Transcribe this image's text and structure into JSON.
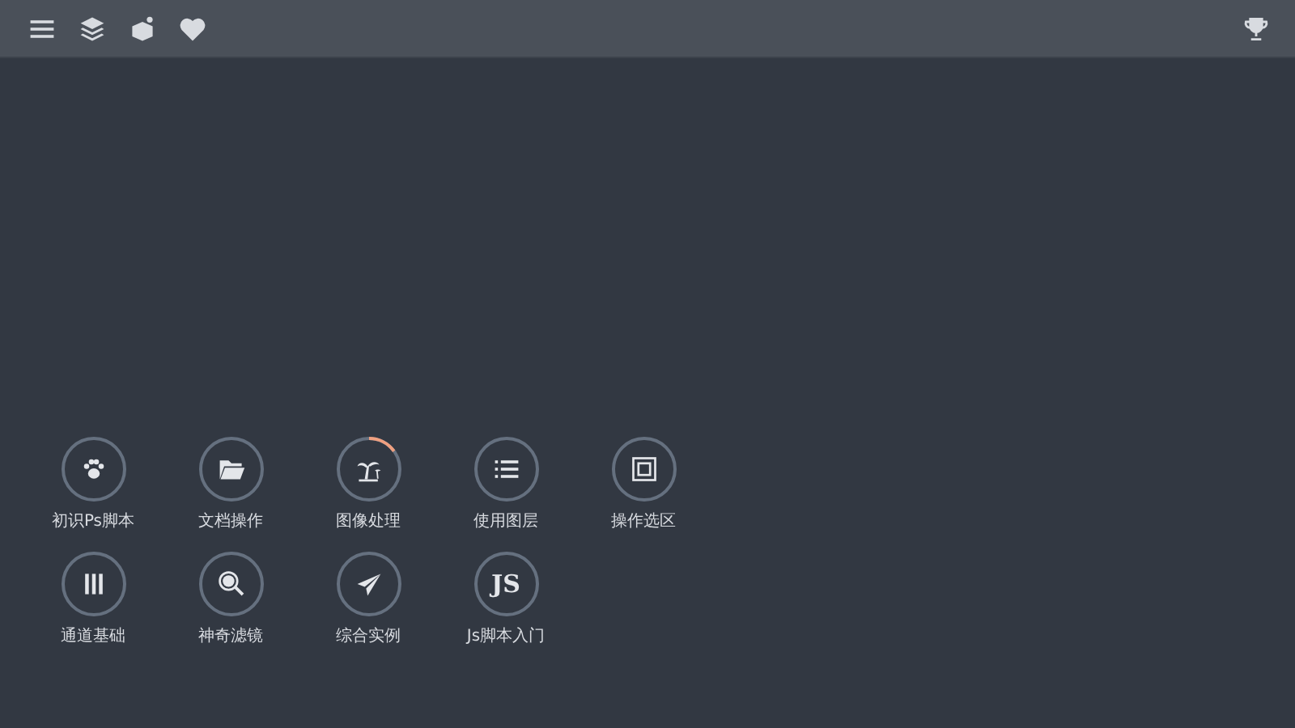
{
  "toolbar": {
    "icons": [
      {
        "kind": "menu"
      },
      {
        "kind": "layers"
      },
      {
        "kind": "cube"
      },
      {
        "kind": "heart"
      }
    ],
    "right_icon": {
      "kind": "trophy"
    }
  },
  "lessons": [
    {
      "label": "初识Ps脚本",
      "kind": "paw",
      "in_progress": false
    },
    {
      "label": "文档操作",
      "kind": "folder",
      "in_progress": false
    },
    {
      "label": "图像处理",
      "kind": "palm",
      "in_progress": true
    },
    {
      "label": "使用图层",
      "kind": "list",
      "in_progress": false
    },
    {
      "label": "操作选区",
      "kind": "square",
      "in_progress": false
    },
    {
      "label": "通道基础",
      "kind": "bars",
      "in_progress": false
    },
    {
      "label": "神奇滤镜",
      "kind": "magnifier",
      "in_progress": false
    },
    {
      "label": "综合实例",
      "kind": "plane",
      "in_progress": false
    },
    {
      "label": "Js脚本入门",
      "kind": "text",
      "icon_text": "JS",
      "in_progress": false
    }
  ]
}
